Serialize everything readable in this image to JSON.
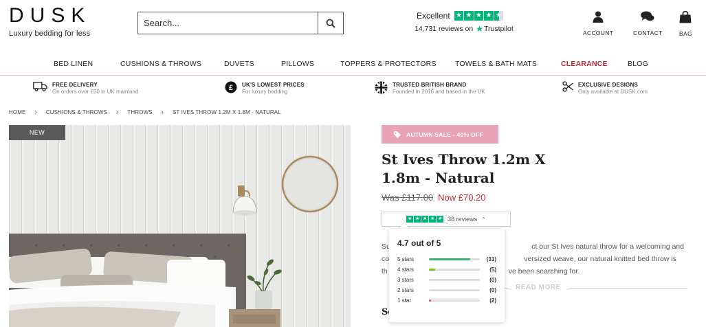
{
  "brand": {
    "name": "DUSK",
    "tagline": "Luxury bedding for less"
  },
  "search": {
    "placeholder": "Search..."
  },
  "trustpilot": {
    "rating_word": "Excellent",
    "reviews_text": "14,731 reviews on",
    "brand": "Trustpilot",
    "stars": 4.5,
    "color": "#00b67a"
  },
  "header_icons": [
    {
      "label": "ACCOUNT",
      "icon": "user-icon"
    },
    {
      "label": "CONTACT",
      "icon": "chat-icon"
    },
    {
      "label": "BAG",
      "icon": "bag-icon"
    }
  ],
  "nav": [
    "BED LINEN",
    "CUSHIONS & THROWS",
    "DUVETS",
    "PILLOWS",
    "TOPPERS & PROTECTORS",
    "TOWELS & BATH MATS",
    "CLEARANCE",
    "BLOG"
  ],
  "usps": [
    {
      "title": "FREE DELIVERY",
      "sub": "On orders over £50 in UK mainland",
      "icon": "truck-icon"
    },
    {
      "title": "UK'S LOWEST PRICES",
      "sub": "For luxury bedding",
      "icon": "pound-icon"
    },
    {
      "title": "TRUSTED BRITISH BRAND",
      "sub": "Founded in 2016 and based in the UK",
      "icon": "union-jack-icon"
    },
    {
      "title": "EXCLUSIVE DESIGNS",
      "sub": "Only available at DUSK.com",
      "icon": "scissors-icon"
    }
  ],
  "breadcrumb": [
    "HOME",
    "CUSHIONS & THROWS",
    "THROWS",
    "ST IVES THROW 1.2M X 1.8M - NATURAL"
  ],
  "product": {
    "badge_new": "NEW",
    "sale_badge": "AUTUMN SALE - 40% OFF",
    "title": "St Ives Throw 1.2m X 1.8m - Natural",
    "was_price": "Was £117.00",
    "now_price": "Now £70.20",
    "reviews_count": "38 reviews",
    "description_visible_left": [
      "Su",
      "co",
      "th"
    ],
    "description_visible_right": [
      "ct our St Ives natural throw for a welcoming and",
      "versized weave, our natural knitted bed throw is",
      "ve been searching for."
    ],
    "read_more": "READ MORE",
    "size_label": "Se"
  },
  "rating_popup": {
    "title": "4.7 out of 5",
    "rows": [
      {
        "label": "5 stars",
        "count": "(31)",
        "fraction": 0.82,
        "color": "#3fae6e"
      },
      {
        "label": "4 stars",
        "count": "(5)",
        "fraction": 0.13,
        "color": "#73cf11"
      },
      {
        "label": "3 stars",
        "count": "(0)",
        "fraction": 0,
        "color": "#ffce00"
      },
      {
        "label": "2 stars",
        "count": "(0)",
        "fraction": 0,
        "color": "#ff8622"
      },
      {
        "label": "1 star",
        "count": "(2)",
        "fraction": 0.05,
        "color": "#e0454b"
      }
    ]
  }
}
